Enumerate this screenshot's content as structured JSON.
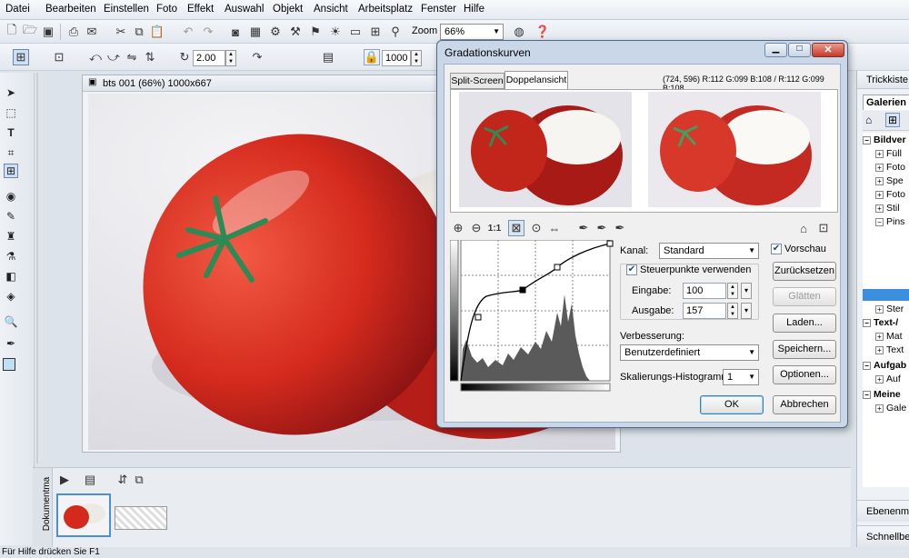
{
  "menu": [
    "Datei",
    "Bearbeiten",
    "Einstellen",
    "Foto",
    "Effekt",
    "Auswahl",
    "Objekt",
    "Ansicht",
    "Arbeitsplatz",
    "Fenster",
    "Hilfe"
  ],
  "toolbar": {
    "zoom_label": "Zoom",
    "zoom_value": "66%",
    "rotate_value": "2.00",
    "size_value": "1000"
  },
  "document": {
    "title": "bts 001 (66%) 1000x667"
  },
  "right_panel": {
    "trickkiste": "Trickkiste",
    "galerien_tab": "Galerien",
    "tree": [
      "Bildver",
      "Füll",
      "Foto",
      "Spe",
      "Foto",
      "Stil",
      "Pins",
      "Ster",
      "Text-/",
      "Mat",
      "Text",
      "Aufgab",
      "Auf",
      "Meine",
      "Gale"
    ],
    "ebenen": "Ebenenma",
    "schnell": "Schnellbe"
  },
  "filmstrip": {
    "side_label": "Dokumentma"
  },
  "status": {
    "text": "Für Hilfe drücken Sie F1"
  },
  "dialog": {
    "title": "Gradationskurven",
    "tabs": [
      "Split-Screen",
      "Doppelansicht"
    ],
    "pixel_info": "(724, 596) R:112 G:099 B:108 / R:112 G:099 B:108",
    "zoom_tools": [
      "zoom-in",
      "zoom-out",
      "1:1"
    ],
    "kanal_label": "Kanal:",
    "kanal_value": "Standard",
    "vorschau": "Vorschau",
    "steuerpunkte": "Steuerpunkte verwenden",
    "eingabe_label": "Eingabe:",
    "eingabe_value": "100",
    "ausgabe_label": "Ausgabe:",
    "ausgabe_value": "157",
    "verbesserung_label": "Verbesserung:",
    "verbesserung_value": "Benutzerdefiniert",
    "skalierung_label": "Skalierungs-Histogramm:",
    "skalierung_value": "1",
    "buttons": {
      "reset": "Zurücksetzen",
      "smooth": "Glätten",
      "load": "Laden...",
      "save": "Speichern...",
      "options": "Optionen...",
      "ok": "OK",
      "cancel": "Abbrechen"
    }
  }
}
